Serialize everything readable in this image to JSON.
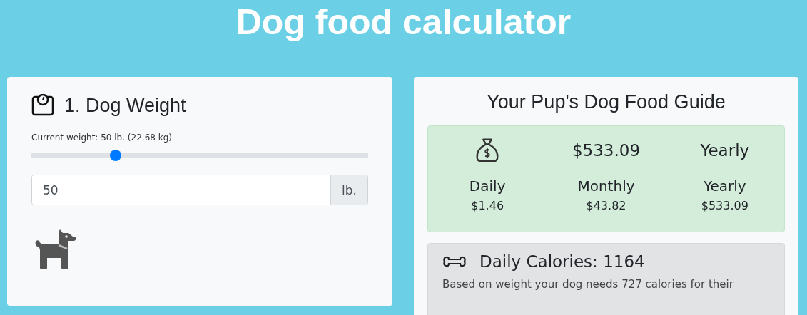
{
  "title": "Dog food calculator",
  "weight_panel": {
    "heading": "1. Dog Weight",
    "current_weight": "Current weight: 50 lb. (22.68 kg)",
    "slider": {
      "level": 0.25
    },
    "weight_field": {
      "value": "50",
      "unit": "lb."
    }
  },
  "guide_panel": {
    "heading": "Your Pup's Dog Food Guide",
    "cost": {
      "headline_amount": "$533.09",
      "headline_period": "Yearly",
      "periods": [
        {
          "label": "Daily",
          "amount": "$1.46"
        },
        {
          "label": "Monthly",
          "amount": "$43.82"
        },
        {
          "label": "Yearly",
          "amount": "$533.09"
        }
      ]
    },
    "calories": {
      "heading": "Daily Calories: 1164",
      "text": "Based on weight your dog needs 727 calories for their"
    }
  }
}
